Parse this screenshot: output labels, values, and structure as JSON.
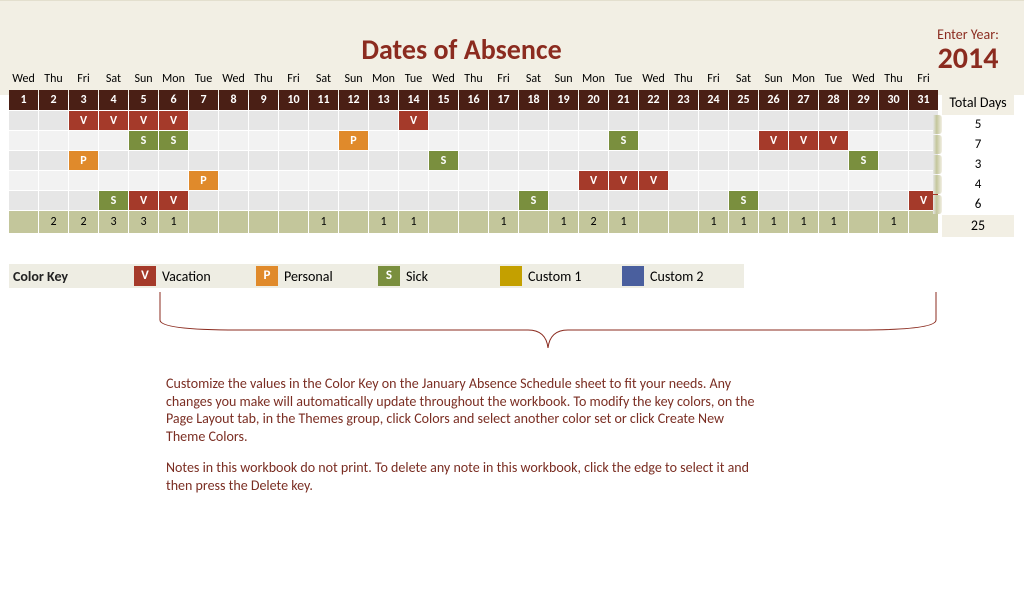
{
  "header": {
    "title": "Dates of Absence",
    "year_label": "Enter Year:",
    "year_value": "2014",
    "totals_header": "Total Days"
  },
  "days_of_week": [
    "Wed",
    "Thu",
    "Fri",
    "Sat",
    "Sun",
    "Mon",
    "Tue",
    "Wed",
    "Thu",
    "Fri",
    "Sat",
    "Sun",
    "Mon",
    "Tue",
    "Wed",
    "Thu",
    "Fri",
    "Sat",
    "Sun",
    "Mon",
    "Tue",
    "Wed",
    "Thu",
    "Fri",
    "Sat",
    "Sun",
    "Mon",
    "Tue",
    "Wed",
    "Thu",
    "Fri"
  ],
  "day_numbers": [
    "1",
    "2",
    "3",
    "4",
    "5",
    "6",
    "7",
    "8",
    "9",
    "10",
    "11",
    "12",
    "13",
    "14",
    "15",
    "16",
    "17",
    "18",
    "19",
    "20",
    "21",
    "22",
    "23",
    "24",
    "25",
    "26",
    "27",
    "28",
    "29",
    "30",
    "31"
  ],
  "rows": [
    {
      "marks": {
        "3": "V",
        "4": "V",
        "5": "V",
        "6": "V",
        "14": "V"
      },
      "total": "5"
    },
    {
      "marks": {
        "5": "S",
        "6": "S",
        "12": "P",
        "21": "S",
        "26": "V",
        "27": "V",
        "28": "V"
      },
      "total": "7"
    },
    {
      "marks": {
        "3": "P",
        "15": "S",
        "29": "S"
      },
      "total": "3"
    },
    {
      "marks": {
        "7": "P",
        "20": "V",
        "21": "V",
        "22": "V"
      },
      "total": "4"
    },
    {
      "marks": {
        "4": "S",
        "5": "V",
        "6": "V",
        "18": "S",
        "25": "S",
        "31": "V"
      },
      "total": "6"
    }
  ],
  "column_totals": [
    "",
    "2",
    "2",
    "3",
    "3",
    "1",
    "",
    "",
    "",
    "",
    "1",
    "",
    "1",
    "1",
    "",
    "",
    "1",
    "",
    "1",
    "2",
    "1",
    "",
    "",
    "1",
    "1",
    "1",
    "1",
    "1",
    "",
    "1"
  ],
  "grand_total": "25",
  "color_key": {
    "title": "Color Key",
    "items": [
      {
        "code": "V",
        "label": "Vacation",
        "sw": "sw-V"
      },
      {
        "code": "P",
        "label": "Personal",
        "sw": "sw-P"
      },
      {
        "code": "S",
        "label": "Sick",
        "sw": "sw-S"
      },
      {
        "code": "",
        "label": "Custom 1",
        "sw": "sw-C1"
      },
      {
        "code": "",
        "label": "Custom 2",
        "sw": "sw-C2"
      }
    ]
  },
  "notes": {
    "p1": "Customize the values in the Color Key on the January Absence Schedule sheet to fit your needs. Any changes you make will automatically update throughout the workbook.  To modify the key colors, on the Page Layout tab, in the Themes group, click Colors and select another color set or click Create New Theme Colors.",
    "p2": "Notes in this workbook do not print. To delete any note in this workbook, click the edge to select it and then press the Delete key."
  },
  "chart_data": {
    "type": "table",
    "title": "Dates of Absence",
    "year": 2014,
    "legend": {
      "V": "Vacation",
      "P": "Personal",
      "S": "Sick",
      "C1": "Custom 1",
      "C2": "Custom 2"
    },
    "columns_day_of_week": [
      "Wed",
      "Thu",
      "Fri",
      "Sat",
      "Sun",
      "Mon",
      "Tue",
      "Wed",
      "Thu",
      "Fri",
      "Sat",
      "Sun",
      "Mon",
      "Tue",
      "Wed",
      "Thu",
      "Fri",
      "Sat",
      "Sun",
      "Mon",
      "Tue",
      "Wed",
      "Thu",
      "Fri",
      "Sat",
      "Sun",
      "Mon",
      "Tue",
      "Wed",
      "Thu",
      "Fri"
    ],
    "columns_day_number": [
      1,
      2,
      3,
      4,
      5,
      6,
      7,
      8,
      9,
      10,
      11,
      12,
      13,
      14,
      15,
      16,
      17,
      18,
      19,
      20,
      21,
      22,
      23,
      24,
      25,
      26,
      27,
      28,
      29,
      30,
      31
    ],
    "employee_rows": [
      {
        "absences": {
          "3": "V",
          "4": "V",
          "5": "V",
          "6": "V",
          "14": "V"
        },
        "total_days": 5
      },
      {
        "absences": {
          "5": "S",
          "6": "S",
          "12": "P",
          "21": "S",
          "26": "V",
          "27": "V",
          "28": "V"
        },
        "total_days": 7
      },
      {
        "absences": {
          "3": "P",
          "15": "S",
          "29": "S"
        },
        "total_days": 3
      },
      {
        "absences": {
          "7": "P",
          "20": "V",
          "21": "V",
          "22": "V"
        },
        "total_days": 4
      },
      {
        "absences": {
          "4": "S",
          "5": "V",
          "6": "V",
          "18": "S",
          "25": "S",
          "31": "V"
        },
        "total_days": 6
      }
    ],
    "per_day_totals": [
      null,
      2,
      2,
      3,
      3,
      1,
      null,
      null,
      null,
      null,
      1,
      null,
      1,
      1,
      null,
      null,
      1,
      null,
      1,
      2,
      1,
      null,
      null,
      1,
      1,
      1,
      1,
      1,
      null,
      1
    ],
    "grand_total": 25
  }
}
